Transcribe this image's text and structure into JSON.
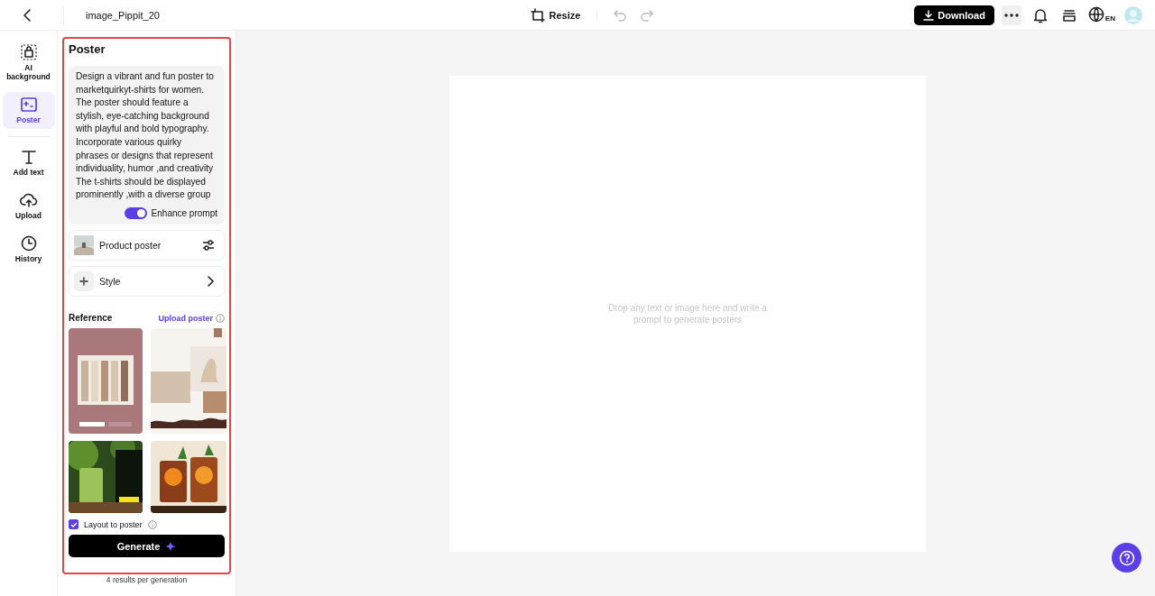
{
  "topbar": {
    "title": "image_Pippit_20",
    "resize_label": "Resize",
    "download_label": "Download",
    "language": "EN"
  },
  "rail": [
    {
      "label": "AI background",
      "selected": false
    },
    {
      "label": "Poster",
      "selected": true
    },
    {
      "label": "Add text",
      "selected": false
    },
    {
      "label": "Upload",
      "selected": false
    },
    {
      "label": "History",
      "selected": false
    }
  ],
  "panel": {
    "title": "Poster",
    "prompt": "Design a vibrant and fun poster to marketquirkyt-shirts for women. The poster should feature a stylish, eye-catching background with playful and bold typography. Incorporate various quirky phrases or designs that represent individuality, humor ,and creativity The t-shirts should be displayed prominently ,with a diverse group",
    "enhance": {
      "label": "Enhance prompt",
      "on": true
    },
    "options": [
      {
        "label": "Product poster",
        "kind": "thumb"
      },
      {
        "label": "Style",
        "kind": "chevron"
      }
    ],
    "reference_label": "Reference",
    "upload_label": "Upload poster",
    "layout": {
      "label": "Layout to poster",
      "checked": true
    },
    "generate_label": "Generate",
    "footnote": "4 results per generation"
  },
  "canvas": {
    "hint": "Drop any text or image here and write a prompt to generate posters"
  }
}
